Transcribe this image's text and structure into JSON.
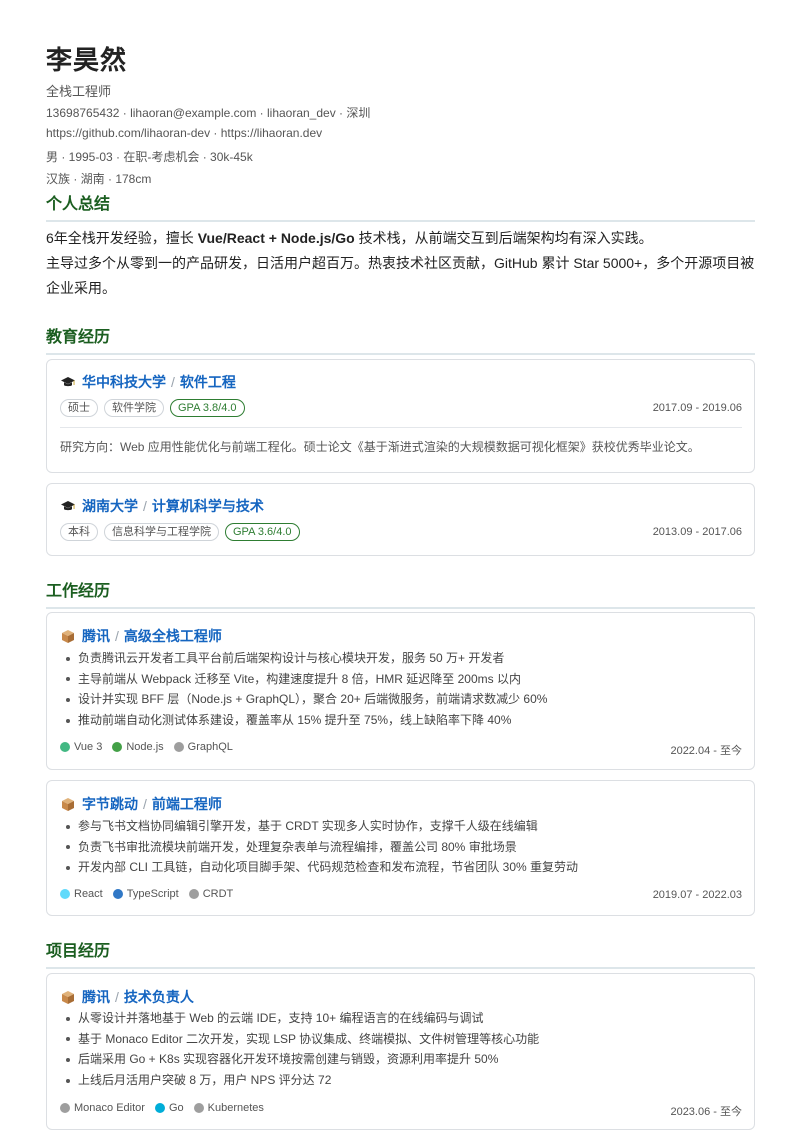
{
  "header": {
    "name": "李昊然",
    "title": "全栈工程师",
    "contact": "13698765432 · lihaoran@example.com · lihaoran_dev · 深圳",
    "links": "https://github.com/lihaoran-dev · https://lihaoran.dev",
    "profile": "男 · 1995-03 · 在职-考虑机会 · 30k-45k",
    "extra": "汉族 · 湖南 · 178cm"
  },
  "summary": {
    "heading": "个人总结",
    "line1_a": "6年全栈开发经验，擅长 ",
    "line1_bold": "Vue/React + Node.js/Go",
    "line1_b": " 技术栈，从前端交互到后端架构均有深入实践。",
    "line2": "主导过多个从零到一的产品研发，日活用户超百万。热衷技术社区贡献，GitHub 累计 Star 5000+，多个开源项目被企业采用。"
  },
  "education": {
    "heading": "教育经历",
    "items": [
      {
        "school": "华中科技大学",
        "major": "软件工程",
        "degree": "硕士",
        "college": "软件学院",
        "gpa": "GPA 3.8/4.0",
        "date": "2017.09 - 2019.06",
        "desc": "研究方向：Web 应用性能优化与前端工程化。硕士论文《基于渐进式渲染的大规模数据可视化框架》获校优秀毕业论文。"
      },
      {
        "school": "湖南大学",
        "major": "计算机科学与技术",
        "degree": "本科",
        "college": "信息科学与工程学院",
        "gpa": "GPA 3.6/4.0",
        "date": "2013.09 - 2017.06"
      }
    ]
  },
  "work": {
    "heading": "工作经历",
    "items": [
      {
        "company": "腾讯",
        "role": "高级全栈工程师",
        "bullets": [
          "负责腾讯云开发者工具平台前后端架构设计与核心模块开发，服务 50 万+ 开发者",
          "主导前端从 Webpack 迁移至 Vite，构建速度提升 8 倍，HMR 延迟降至 200ms 以内",
          "设计并实现 BFF 层（Node.js + GraphQL），聚合 20+ 后端微服务，前端请求数减少 60%",
          "推动前端自动化测试体系建设，覆盖率从 15% 提升至 75%，线上缺陷率下降 40%"
        ],
        "techs": [
          {
            "name": "Vue 3",
            "color": "#42b883"
          },
          {
            "name": "Node.js",
            "color": "#43a047"
          },
          {
            "name": "GraphQL",
            "color": "#9e9e9e"
          }
        ],
        "date": "2022.04 - 至今"
      },
      {
        "company": "字节跳动",
        "role": "前端工程师",
        "bullets": [
          "参与飞书文档协同编辑引擎开发，基于 CRDT 实现多人实时协作，支撑千人级在线编辑",
          "负责飞书审批流模块前端开发，处理复杂表单与流程编排，覆盖公司 80% 审批场景",
          "开发内部 CLI 工具链，自动化项目脚手架、代码规范检查和发布流程，节省团队 30% 重复劳动"
        ],
        "techs": [
          {
            "name": "React",
            "color": "#61dafb"
          },
          {
            "name": "TypeScript",
            "color": "#3178c6"
          },
          {
            "name": "CRDT",
            "color": "#9e9e9e"
          }
        ],
        "date": "2019.07 - 2022.03"
      }
    ]
  },
  "projects": {
    "heading": "项目经历",
    "items": [
      {
        "company": "腾讯",
        "role": "技术负责人",
        "bullets": [
          "从零设计并落地基于 Web 的云端 IDE，支持 10+ 编程语言的在线编码与调试",
          "基于 Monaco Editor 二次开发，实现 LSP 协议集成、终端模拟、文件树管理等核心功能",
          "后端采用 Go + K8s 实现容器化开发环境按需创建与销毁，资源利用率提升 50%",
          "上线后月活用户突破 8 万，用户 NPS 评分达 72"
        ],
        "techs": [
          {
            "name": "Monaco Editor",
            "color": "#9e9e9e"
          },
          {
            "name": "Go",
            "color": "#00add8"
          },
          {
            "name": "Kubernetes",
            "color": "#9e9e9e"
          }
        ],
        "date": "2023.06 - 至今"
      }
    ]
  },
  "icons": {
    "education": "graduation-cap-icon",
    "work": "package-box-icon"
  }
}
